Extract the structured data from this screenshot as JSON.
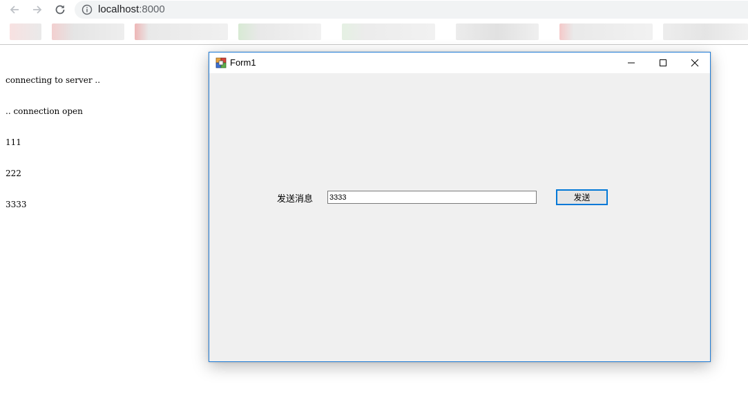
{
  "browser": {
    "url_host": "localhost",
    "url_port": ":8000",
    "icons": {
      "back": "arrow-left-icon",
      "forward": "arrow-right-icon",
      "reload": "reload-icon",
      "site_info": "info-circle-icon"
    }
  },
  "console": {
    "lines": [
      "connecting to server ..",
      ".. connection open",
      "111",
      "222",
      "3333"
    ]
  },
  "window": {
    "title": "Form1",
    "message_label": "发送消息",
    "message_value": "3333",
    "send_label": "发送",
    "icons": {
      "app": "winforms-app-icon",
      "minimize": "minimize-icon",
      "maximize": "maximize-icon",
      "close": "close-icon"
    },
    "colors": {
      "border": "#1e7bd6",
      "client_bg": "#f0f0f0",
      "button_focus": "#0078d7"
    }
  }
}
